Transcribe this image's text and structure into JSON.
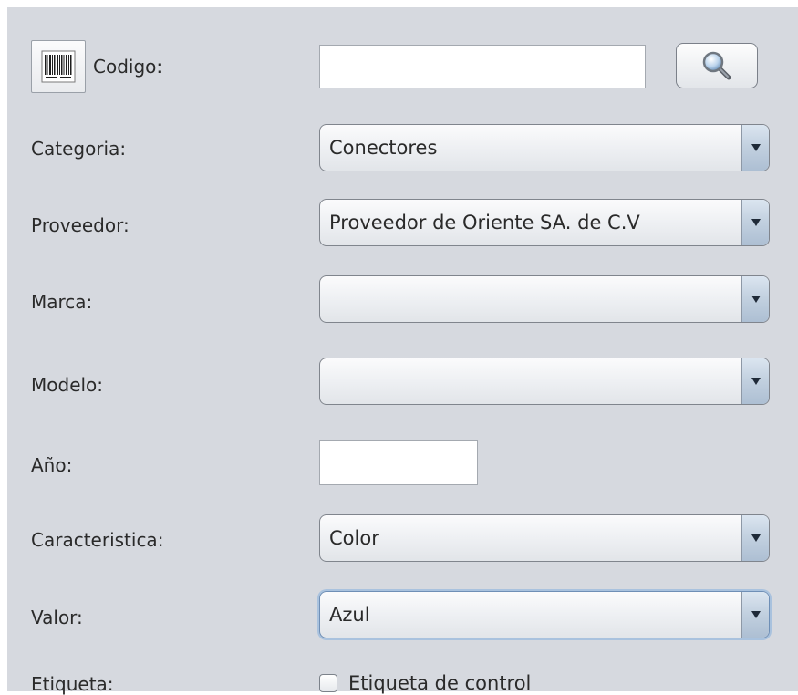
{
  "form": {
    "codigo": {
      "label": "Codigo:",
      "value": "",
      "barcode_icon": "barcode-icon",
      "search_icon": "magnifier-icon"
    },
    "categoria": {
      "label": "Categoria:",
      "value": "Conectores"
    },
    "proveedor": {
      "label": "Proveedor:",
      "value": "Proveedor de Oriente SA. de C.V"
    },
    "marca": {
      "label": "Marca:",
      "value": ""
    },
    "modelo": {
      "label": "Modelo:",
      "value": ""
    },
    "anio": {
      "label": "Año:",
      "value": ""
    },
    "caracteristica": {
      "label": "Caracteristica:",
      "value": "Color"
    },
    "valor": {
      "label": "Valor:",
      "value": "Azul"
    },
    "etiqueta": {
      "label": "Etiqueta:",
      "checkbox_label": "Etiqueta de control",
      "checked": false
    }
  },
  "colors": {
    "panel_background": "#d6d9df",
    "dropdown_arrow": "#1f2a38",
    "focus_ring": "#a9c2de"
  }
}
